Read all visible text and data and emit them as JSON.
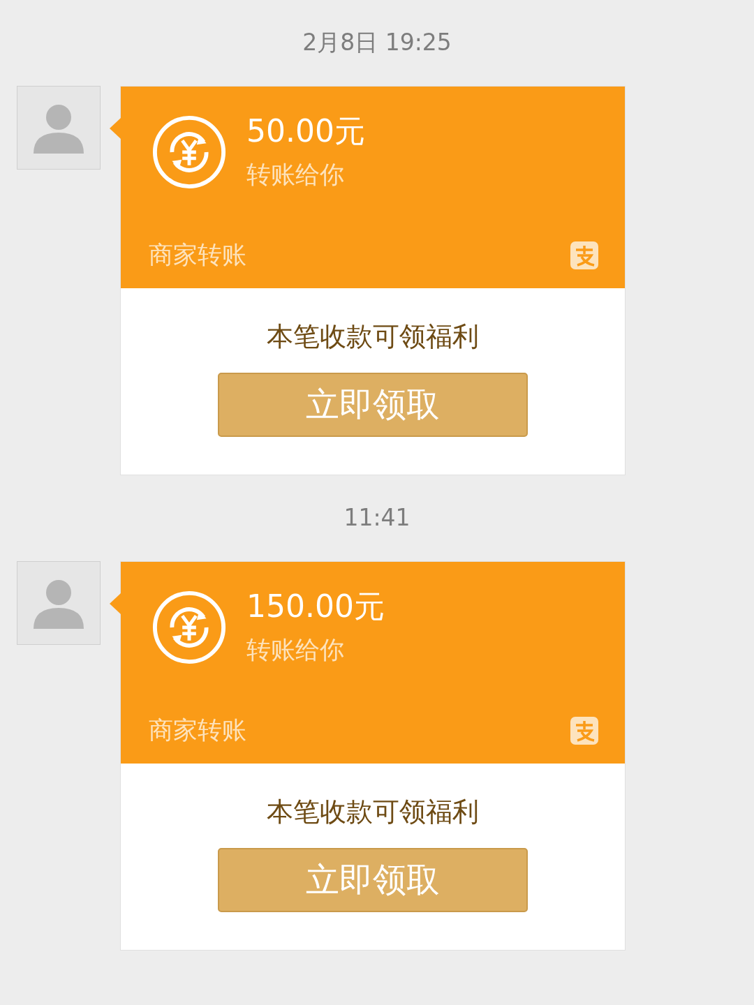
{
  "chat": [
    {
      "kind": "time",
      "text": "2月8日 19:25"
    },
    {
      "kind": "transfer",
      "amount": "50.00元",
      "subtitle": "转账给你",
      "source": "商家转账",
      "promo": "本笔收款可领福利",
      "button": "立即领取"
    },
    {
      "kind": "time",
      "text": "11:41"
    },
    {
      "kind": "transfer",
      "amount": "150.00元",
      "subtitle": "转账给你",
      "source": "商家转账",
      "promo": "本笔收款可领福利",
      "button": "立即领取"
    }
  ]
}
